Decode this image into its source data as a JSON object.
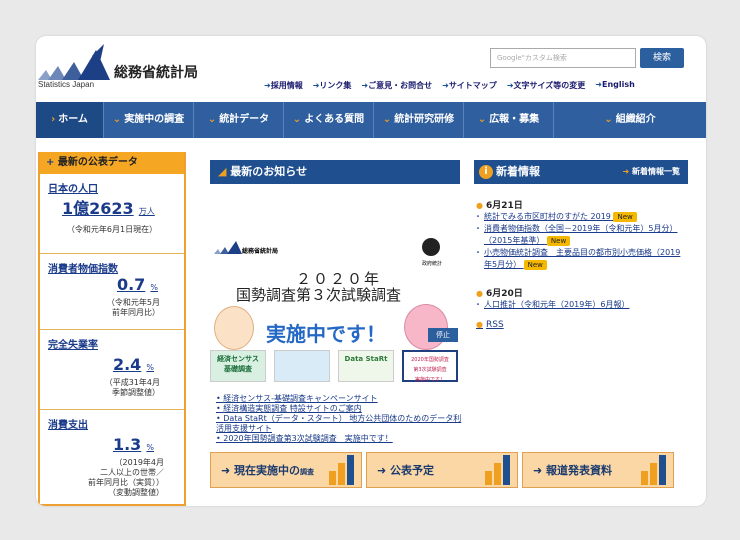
{
  "header": {
    "logo_jp": "総務省統計局",
    "logo_en": "Statistics Japan",
    "search_placeholder": "Google\"カスタム検索",
    "search_button": "検索",
    "links": [
      "採用情報",
      "リンク集",
      "ご意見・お問合せ",
      "サイトマップ",
      "文字サイズ等の変更",
      "English"
    ]
  },
  "nav": {
    "items": [
      "ホーム",
      "実施中の調査",
      "統計データ",
      "よくある質問",
      "統計研究研修",
      "広報・募集",
      "組織紹介"
    ]
  },
  "left": {
    "title": "最新の公表データ",
    "stats": [
      {
        "title": "日本の人口",
        "value": "1億2623",
        "unit": "万人",
        "note": "（令和元年6月1日現在）"
      },
      {
        "title": "消費者物価指数",
        "value": "0.7",
        "unit": "%",
        "note": "（令和元年5月\n前年同月比）"
      },
      {
        "title": "完全失業率",
        "value": "2.4",
        "unit": "%",
        "note": "（平成31年4月\n季節調整値）"
      },
      {
        "title": "消費支出",
        "value": "1.3",
        "unit": "%",
        "note": "（2019年4月\n二人以上の世帯／\n前年同月比（実質））\n（変動調整値）"
      }
    ]
  },
  "center": {
    "title": "最新のお知らせ",
    "banner": {
      "org": "総務省統計局",
      "org_right": "政府統計",
      "line1": "２０２０年",
      "line2": "国勢調査第３次試験調査",
      "line3": "実施中です！",
      "stop": "停止"
    },
    "thumbs": [
      "経済センサス\n基礎調査",
      "",
      "Data StaRt",
      "2020年国勢調査\n第3次試験調査\n実施中です！"
    ],
    "links": [
      "経済センサス-基礎調査キャンペーンサイト",
      "経済構造実態調査 特設サイトのご案内",
      "Data StaRt（データ・スタート） 地方公共団体のためのデータ利活用支援サイト",
      "2020年国勢調査第3次試験調査　実施中です！"
    ],
    "buttons": [
      {
        "label": "現在実施中の",
        "small": "調査"
      },
      {
        "label": "公表予定",
        "small": ""
      },
      {
        "label": "報道発表資料",
        "small": ""
      }
    ]
  },
  "right": {
    "title": "新着情報",
    "more": "新着情報一覧",
    "groups": [
      {
        "date": "6月21日",
        "items": [
          {
            "text": "統計でみる市区町村のすがた 2019",
            "badge": "New"
          },
          {
            "text": "消費者物価指数（全国－2019年（令和元年）5月分）（2015年基準）",
            "badge": "New"
          },
          {
            "text": "小売物価統計調査　主要品目の都市別小売価格（2019年5月分）",
            "badge": "New"
          }
        ]
      },
      {
        "date": "6月20日",
        "items": [
          {
            "text": "人口推計（令和元年（2019年）6月報）",
            "badge": ""
          }
        ]
      }
    ],
    "rss": "RSS"
  }
}
